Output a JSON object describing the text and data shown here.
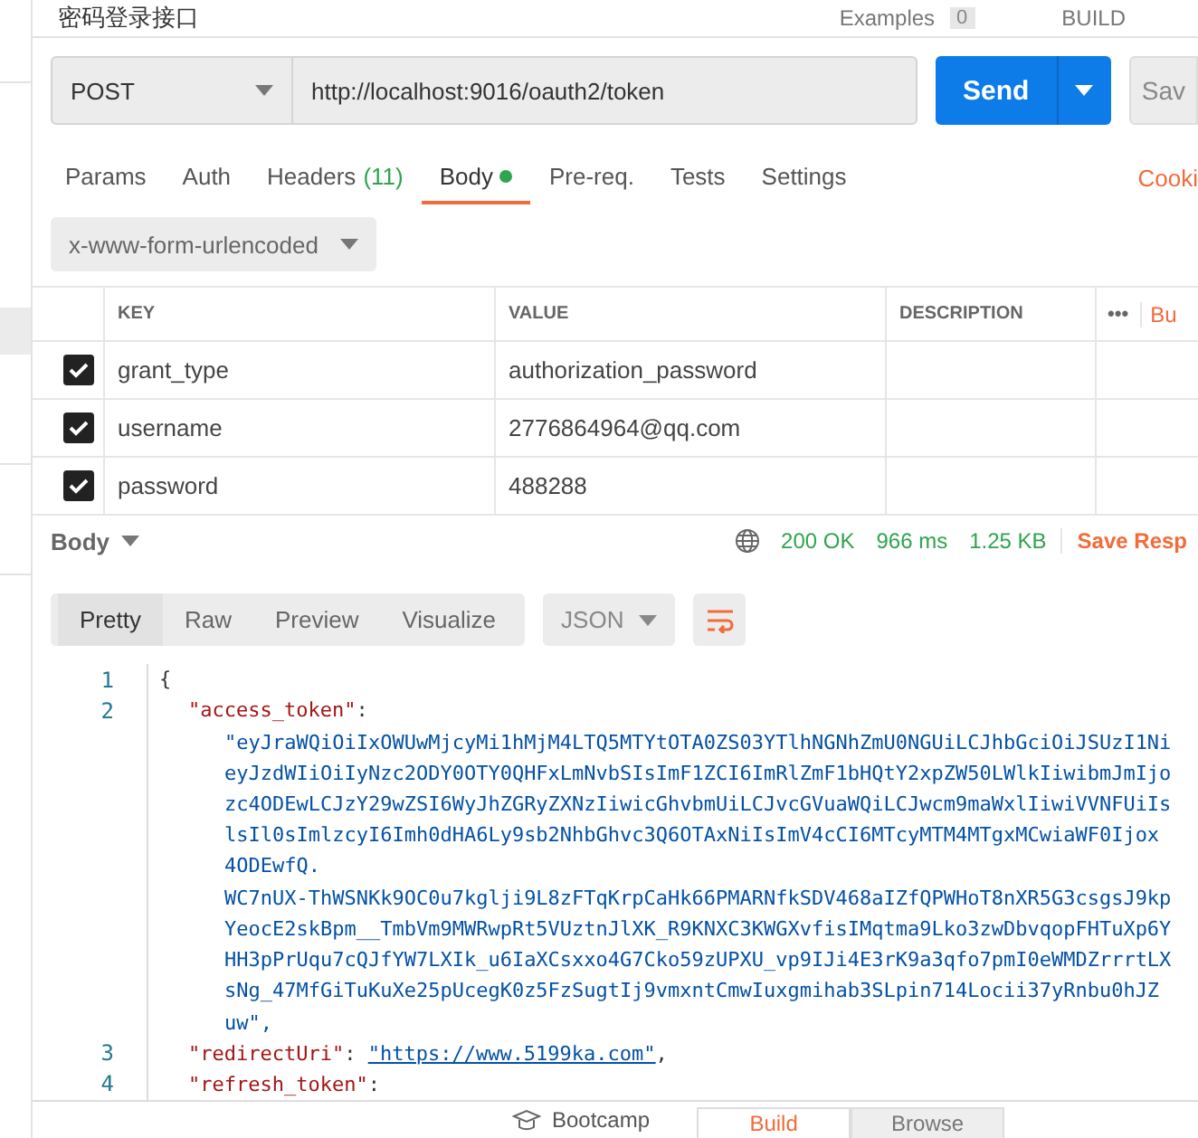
{
  "header": {
    "title": "密码登录接口",
    "examples_label": "Examples",
    "examples_count": "0",
    "build_label": "BUILD"
  },
  "request": {
    "method": "POST",
    "url": "http://localhost:9016/oauth2/token",
    "send": "Send",
    "save": "Sav"
  },
  "tabs": [
    {
      "label": "Params",
      "selected": false
    },
    {
      "label": "Auth",
      "selected": false
    },
    {
      "label": "Headers",
      "count": "(11)",
      "selected": false
    },
    {
      "label": "Body",
      "dot": true,
      "selected": true
    },
    {
      "label": "Pre-req.",
      "selected": false
    },
    {
      "label": "Tests",
      "selected": false
    },
    {
      "label": "Settings",
      "selected": false
    }
  ],
  "cookies_link": "Cooki",
  "body_type": "x-www-form-urlencoded",
  "table": {
    "columns": [
      "KEY",
      "VALUE",
      "DESCRIPTION"
    ],
    "more": "•••",
    "bulk": "Bu",
    "rows": [
      {
        "checked": true,
        "key": "grant_type",
        "value": "authorization_password"
      },
      {
        "checked": true,
        "key": "username",
        "value": "2776864964@qq.com"
      },
      {
        "checked": true,
        "key": "password",
        "value": "488288"
      }
    ]
  },
  "response": {
    "label": "Body",
    "status": "200 OK",
    "time": "966 ms",
    "size": "1.25 KB",
    "save": "Save Resp"
  },
  "view_tabs": [
    {
      "label": "Pretty",
      "selected": true
    },
    {
      "label": "Raw",
      "selected": false
    },
    {
      "label": "Preview",
      "selected": false
    },
    {
      "label": "Visualize",
      "selected": false
    }
  ],
  "format": "JSON",
  "code": [
    {
      "kind": "open",
      "number": "1",
      "text": "{"
    },
    {
      "kind": "key",
      "number": "2",
      "key": "\"access_token\"",
      "sep": ":"
    },
    {
      "kind": "value",
      "text": "\"eyJraWQiOiIxOWUwMjcyMi1hMjM4LTQ5MTYtOTA0ZS03YTlhNGNhZmU0NGUiLCJhbGciOiJSUzI1Ni"
    },
    {
      "kind": "value",
      "text": "eyJzdWIiOiIyNzc2ODY0OTY0QHFxLmNvbSIsImF1ZCI6ImRlZmF1bHQtY2xpZW50LWlkIiwibmJmIjo"
    },
    {
      "kind": "value",
      "text": "zc4ODEwLCJzY29wZSI6WyJhZGRyZXNzIiwicGhvbmUiLCJvcGVuaWQiLCJwcm9maWxlIiwiVVNFUiIs"
    },
    {
      "kind": "value",
      "text": "lsIl0sImlzcyI6Imh0dHA6Ly9sb2NhbGhvc3Q6OTAxNiIsImV4cCI6MTcyMTM4MTgxMCwiaWF0Ijox"
    },
    {
      "kind": "value",
      "text": "4ODEwfQ."
    },
    {
      "kind": "value",
      "text": "WC7nUX-ThWSNKk9OC0u7kglji9L8zFTqKrpCaHk66PMARNfkSDV468aIZfQPWHoT8nXR5G3csgsJ9kp"
    },
    {
      "kind": "value",
      "text": "YeocE2skBpm__TmbVm9MWRwpRt5VUztnJlXK_R9KNXC3KWGXvfisIMqtma9Lko3zwDbvqopFHTuXp6Y"
    },
    {
      "kind": "value",
      "text": "HH3pPrUqu7cQJfYW7LXIk_u6IaXCsxxo4G7Cko59zUPXU_vp9IJi4E3rK9a3qfo7pmI0eWMDZrrrtLX"
    },
    {
      "kind": "value",
      "text": "sNg_47MfGiTuKuXe25pUcegK0z5FzSugtIj9vmxntCmwIuxgmihab3SLpin714Locii37yRnbu0hJZ"
    },
    {
      "kind": "value",
      "text": "uw\","
    },
    {
      "kind": "pair",
      "number": "3",
      "key": "\"redirectUri\"",
      "sep": ": ",
      "link": "\"https://www.5199ka.com\"",
      "tail": ","
    },
    {
      "kind": "key",
      "number": "4",
      "key": "\"refresh_token\"",
      "sep": ":"
    }
  ],
  "footer": {
    "bootcamp": "Bootcamp",
    "tabs": [
      {
        "label": "Build",
        "selected": true
      },
      {
        "label": "Browse",
        "selected": false
      }
    ]
  }
}
